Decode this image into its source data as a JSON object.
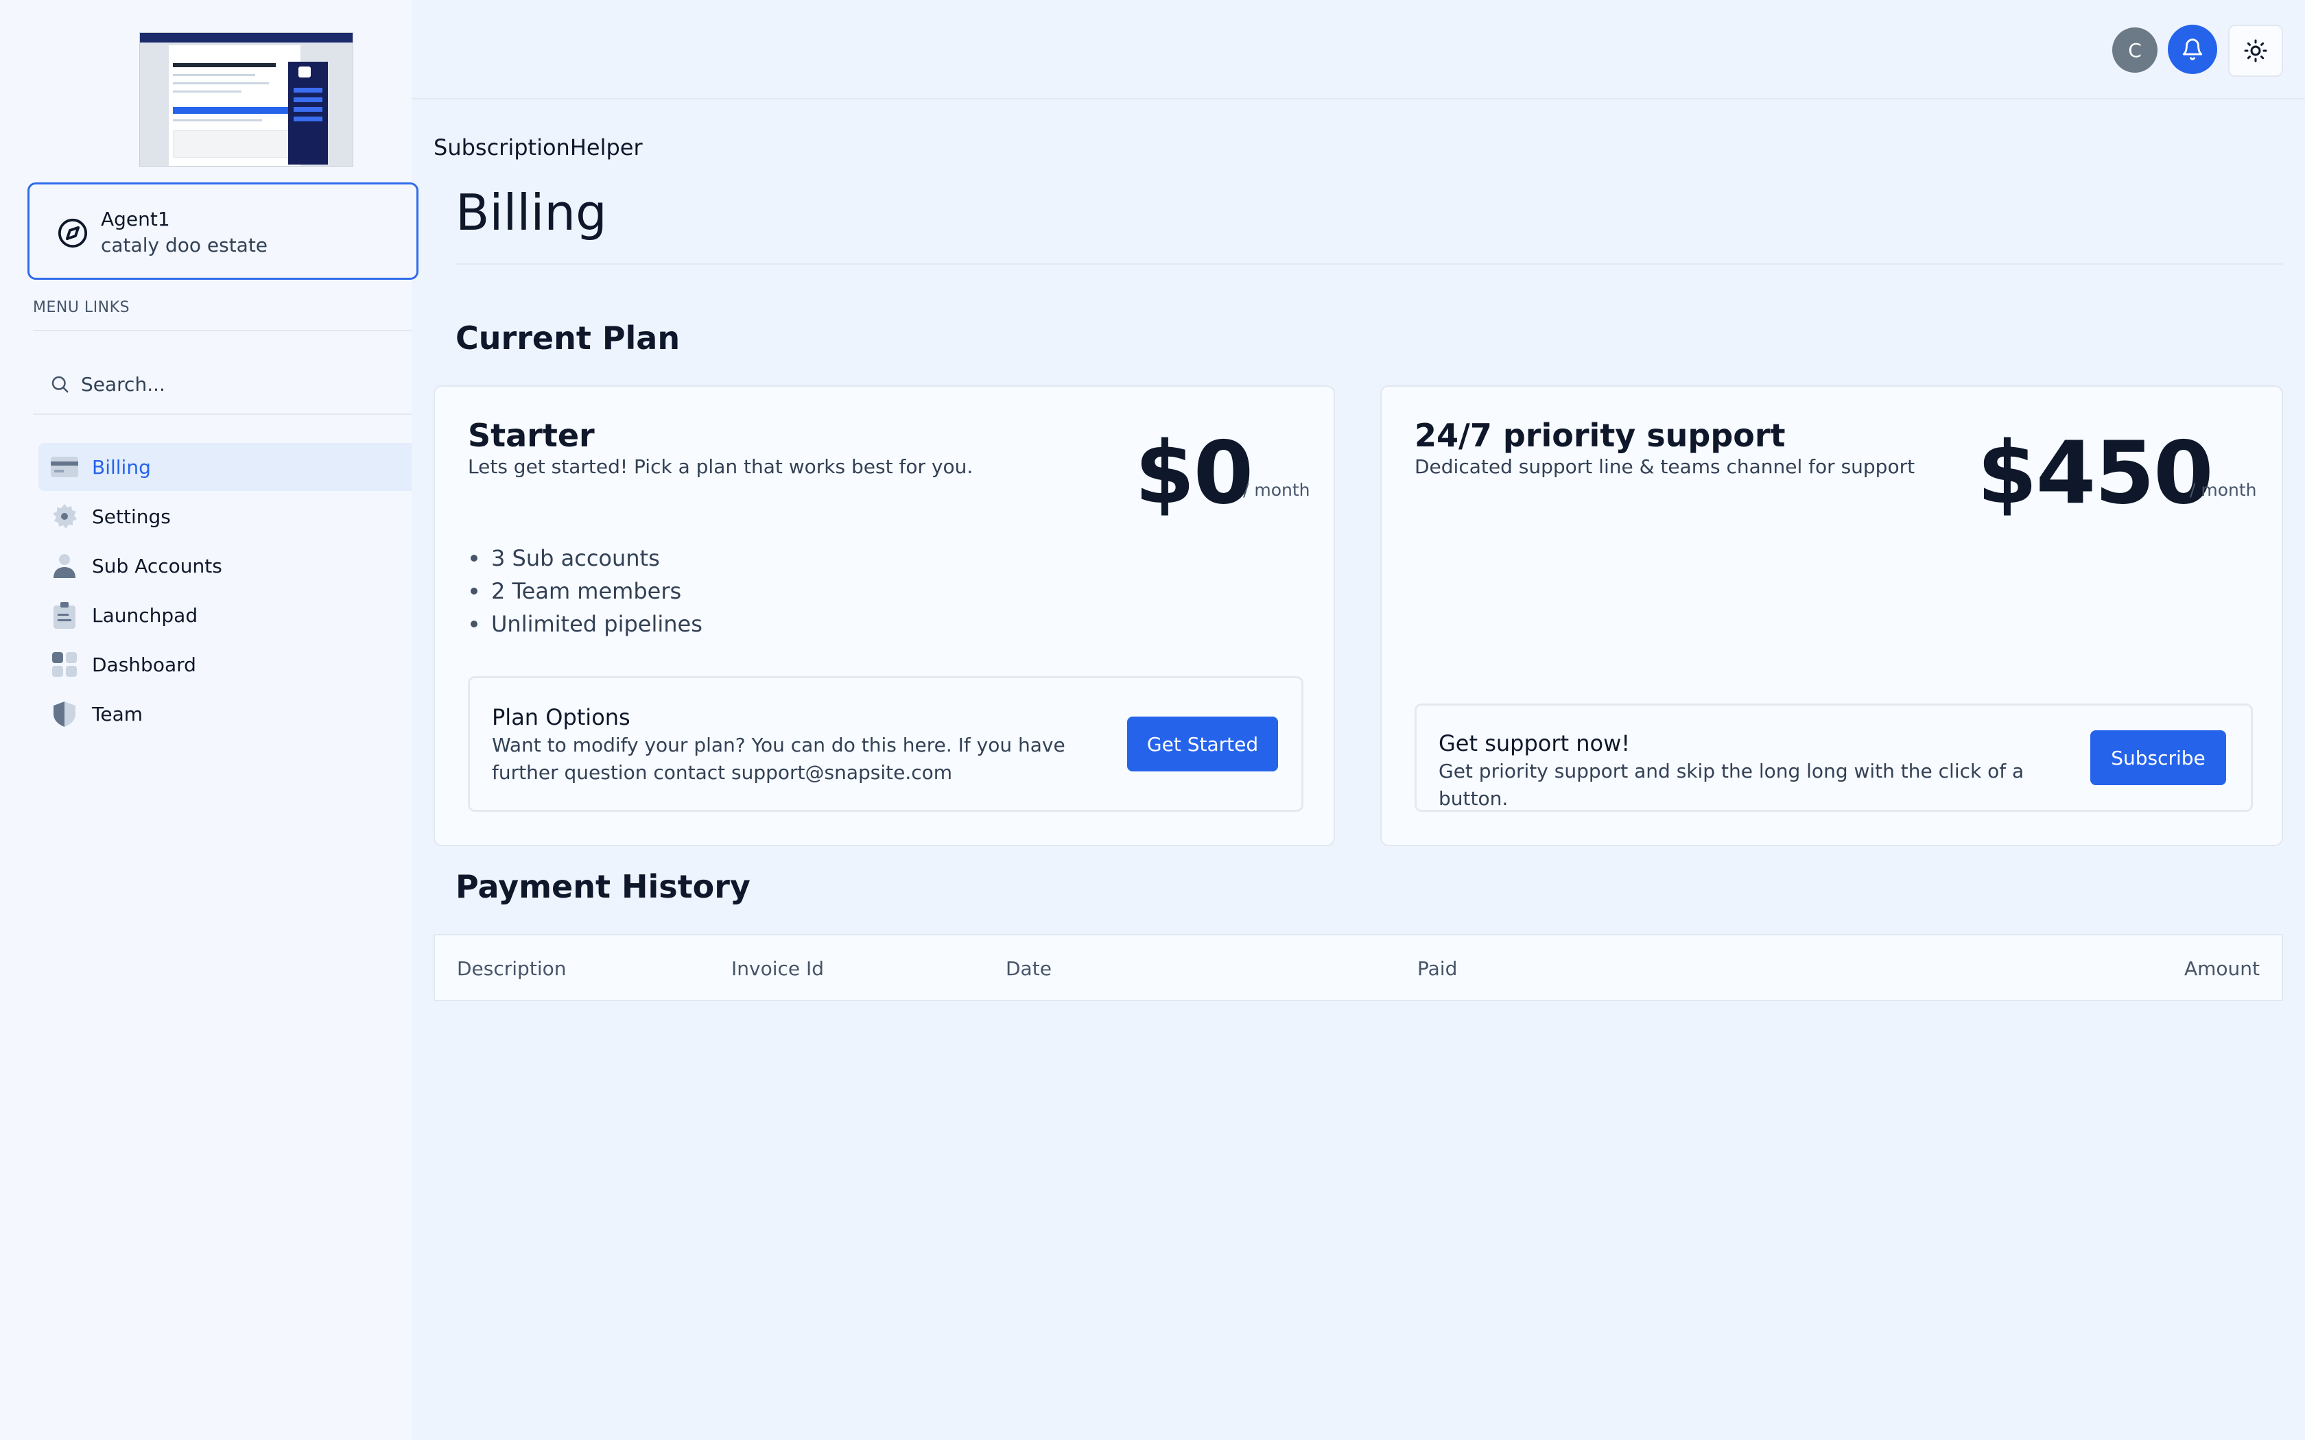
{
  "sidebar": {
    "agent": {
      "name": "Agent1",
      "subtitle": "cataly doo estate"
    },
    "menu_label": "MENU LINKS",
    "search": {
      "placeholder": "Search..."
    },
    "items": [
      {
        "label": "Billing",
        "icon": "credit-card-icon",
        "active": true
      },
      {
        "label": "Settings",
        "icon": "gear-icon",
        "active": false
      },
      {
        "label": "Sub Accounts",
        "icon": "person-icon",
        "active": false
      },
      {
        "label": "Launchpad",
        "icon": "clipboard-icon",
        "active": false
      },
      {
        "label": "Dashboard",
        "icon": "grid-icon",
        "active": false
      },
      {
        "label": "Team",
        "icon": "shield-icon",
        "active": false
      }
    ]
  },
  "header": {
    "avatar_initial": "C",
    "notification_icon": "bell-icon",
    "theme_icon": "sun-icon"
  },
  "page": {
    "breadcrumb": "SubscriptionHelper",
    "title": "Billing"
  },
  "current_plan": {
    "heading": "Current Plan",
    "starter": {
      "name": "Starter",
      "description": "Lets get started! Pick a plan that works best for you.",
      "price": "$0",
      "period": "/ month",
      "features": [
        "3 Sub accounts",
        "2 Team members",
        "Unlimited pipelines"
      ],
      "options": {
        "title": "Plan Options",
        "text": "Want to modify your plan? You can do this here. If you have further question contact support@snapsite.com",
        "button": "Get Started"
      }
    },
    "support": {
      "name": "24/7 priority support",
      "description": "Dedicated support line & teams channel for support",
      "price": "$450",
      "period": "/ month",
      "cta": {
        "title": "Get support now!",
        "text": "Get priority support and skip the long long with the click of a button.",
        "button": "Subscribe"
      }
    }
  },
  "payment_history": {
    "heading": "Payment History",
    "columns": [
      "Description",
      "Invoice Id",
      "Date",
      "Paid",
      "Amount"
    ],
    "rows": []
  },
  "colors": {
    "accent": "#2563eb",
    "background": "#eef4fe",
    "sidebar": "#f4f8fe"
  }
}
